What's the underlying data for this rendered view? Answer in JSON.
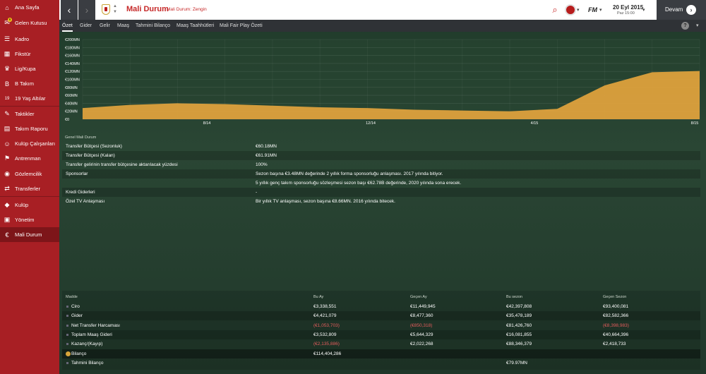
{
  "sidebar": {
    "items": [
      {
        "label": "Ana Sayfa",
        "icon": "home-icon"
      },
      {
        "label": "Gelen Kutusu",
        "icon": "inbox-icon",
        "badge": "6"
      },
      {
        "label": "Kadro",
        "icon": "squad-icon"
      },
      {
        "label": "Fikstür",
        "icon": "fixtures-icon"
      },
      {
        "label": "Lig/Kupa",
        "icon": "trophy-icon"
      },
      {
        "label": "B Takım",
        "icon": "b-team-icon"
      },
      {
        "label": "19 Yaş Altılar",
        "icon": "u19-icon"
      },
      {
        "label": "Taktikler",
        "icon": "tactics-icon"
      },
      {
        "label": "Takım Raporu",
        "icon": "report-icon"
      },
      {
        "label": "Kulüp Çalışanları",
        "icon": "staff-icon"
      },
      {
        "label": "Antrenman",
        "icon": "training-icon"
      },
      {
        "label": "Gözlemcilik",
        "icon": "scouting-icon"
      },
      {
        "label": "Transferler",
        "icon": "transfers-icon"
      },
      {
        "label": "Kulüp",
        "icon": "club-icon"
      },
      {
        "label": "Yönetim",
        "icon": "board-icon"
      },
      {
        "label": "Mali Durum",
        "icon": "finances-icon"
      }
    ]
  },
  "header": {
    "title": "Mali Durum",
    "subtitle": "Mali Durum: Zengin",
    "date": "20 Eyl 2015",
    "time": "Paz 15:00",
    "continue_label": "Devam",
    "logo_text": "FM"
  },
  "tabs": [
    "Özet",
    "Gider",
    "Gelir",
    "Maaş",
    "Tahmini Bilanço",
    "Maaş Taahhütleri",
    "Mali Fair Play Özeti"
  ],
  "chart_data": {
    "type": "area",
    "y_ticks": [
      "€200MN",
      "€180MN",
      "€160MN",
      "€140MN",
      "€120MN",
      "€100MN",
      "€80MN",
      "€60MN",
      "€40MN",
      "€20MN",
      "€0"
    ],
    "x_ticks": [
      "8/14",
      "12/14",
      "4/15",
      "8/15"
    ],
    "x": [
      "8/14",
      "9/14",
      "10/14",
      "11/14",
      "12/14",
      "1/15",
      "2/15",
      "3/15",
      "4/15",
      "5/15",
      "6/15",
      "7/15",
      "8/15",
      "9/15"
    ],
    "values": [
      28,
      36,
      40,
      38,
      34,
      30,
      28,
      24,
      22,
      20,
      26,
      85,
      118,
      121
    ],
    "ylim": [
      0,
      200
    ],
    "color": "#e3a43d",
    "grid": true
  },
  "summary": {
    "title": "Genel Mali Durum",
    "rows": [
      {
        "label": "Transfer Bütçesi (Sezonluk)",
        "value": "€60.18MN"
      },
      {
        "label": "Transfer Bütçesi (Kalan)",
        "value": "€61.91MN"
      },
      {
        "label": "Transfer gelirinin transfer bütçesine aktarılacak yüzdesi",
        "value": "100%"
      },
      {
        "label": "Sponsorlar",
        "value": "Sezon başına €3.48MN değerinde 2 yıllık forma sponsorluğu anlaşması. 2017 yılında bitiyor."
      },
      {
        "label": "",
        "value": "5 yıllık genç takım sponsorluğu sözleşmesi sezon başı €62.78B değerinde, 2020 yılında sona erecek."
      },
      {
        "label": "Kredi Giderleri",
        "value": "-"
      },
      {
        "label": "Özel TV Anlaşması",
        "value": "Bir yıllık TV anlaşması, sezon başına €8.66MN. 2016 yılında bitecek."
      }
    ]
  },
  "table": {
    "headers": [
      "Madde",
      "Bu Ay",
      "Geçen Ay",
      "Bu sezon",
      "Geçen Sezon"
    ],
    "rows": [
      {
        "item": "Ciro",
        "cells": [
          "€3,338,551",
          "€11,449,945",
          "€42,397,808",
          "€93,400,081"
        ],
        "neg": [
          false,
          false,
          false,
          false
        ]
      },
      {
        "item": "Gider",
        "cells": [
          "€4,421,079",
          "€8,477,360",
          "€35,478,189",
          "€82,582,366"
        ],
        "neg": [
          false,
          false,
          false,
          false
        ]
      },
      {
        "item": "Net Transfer Harcaması",
        "cells": [
          "(€1,053,703)",
          "(€850,318)",
          "€81,426,760",
          "(€8,398,983)"
        ],
        "neg": [
          true,
          true,
          false,
          true
        ]
      },
      {
        "item": "Toplam Maaş Gideri",
        "cells": [
          "€3,532,809",
          "€5,644,329",
          "€16,081,855",
          "€40,664,396"
        ],
        "neg": [
          false,
          false,
          false,
          false
        ]
      },
      {
        "item": "Kazanç/(Kayıp)",
        "cells": [
          "(€2,135,886)",
          "€2,022,268",
          "€88,346,379",
          "€2,418,733"
        ],
        "neg": [
          true,
          false,
          false,
          false
        ]
      },
      {
        "item": "Bilanço",
        "cells": [
          "€114,404,286",
          "",
          "",
          ""
        ],
        "neg": [
          false,
          false,
          false,
          false
        ]
      },
      {
        "item": "Tahmini Bilanço",
        "cells": [
          "",
          "",
          "€79.97MN",
          ""
        ],
        "neg": [
          false,
          false,
          false,
          false
        ]
      }
    ]
  }
}
